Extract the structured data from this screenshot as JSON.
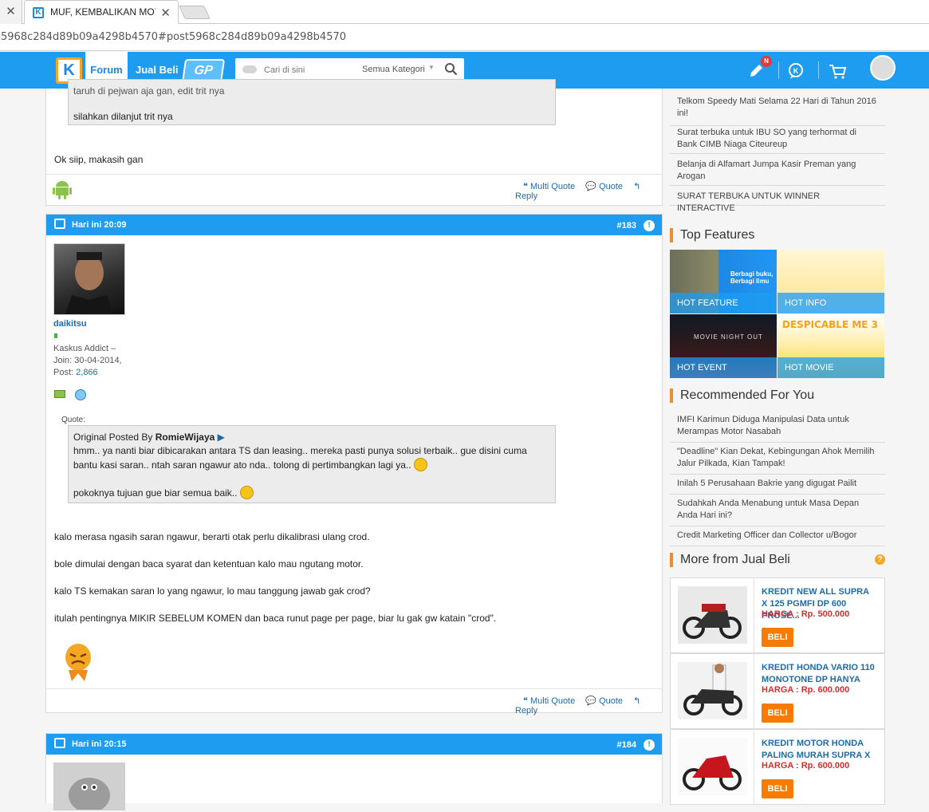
{
  "browser": {
    "tab_title": "MUF, KEMBALIKAN MOT",
    "url": "5968c284d89b09a4298b4570#post5968c284d89b09a4298b4570"
  },
  "header": {
    "logo": "K",
    "forum_label": "Forum",
    "jualbeli_label": "Jual Beli",
    "gp_label": "GP",
    "search_placeholder": "Cari di sini",
    "search_category": "Semua Kategori",
    "notif_count": "N",
    "accent": "#1e9cf0"
  },
  "prev_post": {
    "quote_partial": "taruh di pejwan aja gan, edit trit nya",
    "quote_line2": "silahkan dilanjut trit nya",
    "text": "Ok siip, makasih gan",
    "device_icon": "android-icon"
  },
  "actions": {
    "multi_quote": "Multi Quote",
    "quote": "Quote",
    "reply": "Reply"
  },
  "post183": {
    "date": "Hari ini 20:09",
    "number": "#183",
    "username": "daikitsu",
    "rank": "Kaskus Addict –",
    "join": "Join: 30-04-2014,",
    "post_label": "Post:",
    "post_count": "2,866",
    "quote_label": "Quote:",
    "quote_by_prefix": "Original Posted By",
    "quote_author": "RomieWijaya",
    "quote_line1": "hmm.. ya nanti biar dibicarakan antara TS dan leasing.. mereka pasti punya solusi terbaik.. gue disini cuma",
    "quote_line2": "bantu kasi saran.. ntah saran ngawur ato nda.. tolong di pertimbangkan lagi ya..",
    "quote_line3": "pokoknya tujuan gue biar semua baik..",
    "body": [
      "kalo merasa ngasih saran ngawur, berarti otak perlu dikalibrasi ulang crod.",
      "bole dimulai dengan baca syarat dan ketentuan kalo mau ngutang motor.",
      "kalo TS kemakan saran lo yang ngawur, lo mau tanggung jawab gak crod?",
      "itulah pentingnya MIKIR SEBELUM KOMEN dan baca runut page per page, biar lu gak gw katain \"crod\"."
    ]
  },
  "post184": {
    "date": "Hari ini 20:15",
    "number": "#184"
  },
  "sidebar": {
    "top_list": [
      "Telkom Speedy Mati Selama 22 Hari di Tahun 2016 ini!",
      "Surat terbuka untuk IBU SO yang terhormat di Bank CIMB Niaga Citeureup",
      "Belanja di Alfamart Jumpa Kasir Preman yang Arogan",
      "SURAT TERBUKA UNTUK WINNER INTERACTIVE"
    ],
    "top_features_title": "Top Features",
    "features": [
      {
        "label": "HOT FEATURE",
        "caption": "Berbagi buku, Berbagi Ilmu"
      },
      {
        "label": "HOT INFO",
        "caption": ""
      },
      {
        "label": "HOT EVENT",
        "caption": "MOVIE NIGHT OUT"
      },
      {
        "label": "HOT MOVIE",
        "caption": "DESPICABLE ME 3"
      }
    ],
    "recommended_title": "Recommended For You",
    "recommended": [
      "IMFI Karimun Diduga Manipulasi Data untuk Merampas Motor Nasabah",
      "\"Deadline\" Kian Dekat, Kebingungan Ahok Memilih Jalur Pilkada, Kian Tampak!",
      "Inilah 5 Perusahaan Bakrie yang digugat Pailit",
      "Sudahkah Anda Menabung untuk Masa Depan Anda Hari ini?",
      "Credit Marketing Officer dan Collector u/Bogor"
    ],
    "jualbeli_title": "More from Jual Beli",
    "jualbeli": [
      {
        "title": "KREDIT NEW ALL SUPRA X 125 PGMFI DP 600 PROSE...",
        "price": "HARGA : Rp. 500.000",
        "button": "BELI"
      },
      {
        "title": "KREDIT HONDA VARIO 110 MONOTONE DP HANYA",
        "price": "HARGA : Rp. 600.000",
        "button": "BELI"
      },
      {
        "title": "KREDIT MOTOR HONDA PALING MURAH SUPRA X",
        "price": "HARGA : Rp. 600.000",
        "button": "BELI"
      }
    ]
  }
}
